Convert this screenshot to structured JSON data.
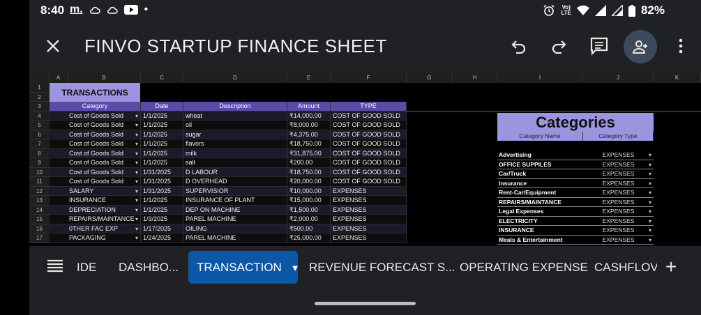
{
  "status_bar": {
    "time": "8:40",
    "battery": "82%",
    "left_icons": [
      "m-app-icon",
      "cloud-icon",
      "cloud-icon",
      "youtube-icon",
      "dot-icon"
    ],
    "right_icons": [
      "alarm-icon",
      "volte-icon",
      "wifi-icon",
      "signal-icon",
      "signal-icon",
      "battery-icon"
    ]
  },
  "app_bar": {
    "title": "FINVO STARTUP FINANCE SHEET",
    "icons": [
      "close-icon",
      "undo-icon",
      "redo-icon",
      "comment-icon",
      "add-person-icon",
      "more-vert-icon"
    ]
  },
  "sheet": {
    "column_headers": [
      "A",
      "B",
      "C",
      "D",
      "E",
      "F",
      "G",
      "H",
      "I",
      "J",
      "K"
    ],
    "row_numbers": [
      "1",
      "2",
      "3",
      "4",
      "5",
      "6",
      "7",
      "8",
      "9",
      "10",
      "11",
      "12",
      "13",
      "14",
      "15",
      "16",
      "17"
    ],
    "transactions_title": "TRANSACTIONS",
    "table_headers": [
      "Category",
      "Date",
      "Description",
      "Amount",
      "TYPE"
    ],
    "rows": [
      {
        "category": "Cost of Goods Sold",
        "date": "1/1/2025",
        "description": "wheat",
        "amount": "₹14,000.00",
        "type": "COST OF GOOD SOLD"
      },
      {
        "category": "Cost of Goods Sold",
        "date": "1/1/2025",
        "description": "oil",
        "amount": "₹8,000.00",
        "type": "COST OF GOOD SOLD"
      },
      {
        "category": "Cost of Goods Sold",
        "date": "1/1/2025",
        "description": "sugar",
        "amount": "₹4,375.00",
        "type": "COST OF GOOD SOLD"
      },
      {
        "category": "Cost of Goods Sold",
        "date": "1/1/2025",
        "description": "flavors",
        "amount": "₹18,750.00",
        "type": "COST OF GOOD SOLD"
      },
      {
        "category": "Cost of Goods Sold",
        "date": "1/1/2025",
        "description": "milk",
        "amount": "₹31,875.00",
        "type": "COST OF GOOD SOLD"
      },
      {
        "category": "Cost of Goods Sold",
        "date": "1/1/2025",
        "description": "salt",
        "amount": "₹200.00",
        "type": "COST OF GOOD SOLD"
      },
      {
        "category": "Cost of Goods Sold",
        "date": "1/31/2025",
        "description": "D LABOUR",
        "amount": "₹18,750.00",
        "type": "COST OF GOOD SOLD"
      },
      {
        "category": "Cost of Goods Sold",
        "date": "1/31/2025",
        "description": "D OVERHEAD",
        "amount": "₹20,000.00",
        "type": "COST OF GOOD SOLD"
      },
      {
        "category": "SALARY",
        "date": "1/31/2025",
        "description": "SUPERVISIOR",
        "amount": "₹10,000.00",
        "type": "EXPENSES"
      },
      {
        "category": "INSURANCE",
        "date": "1/1/2025",
        "description": "INSURANCE OF PLANT",
        "amount": "₹15,000.00",
        "type": "EXPENSES"
      },
      {
        "category": "DEPRECIATION",
        "date": "1/1/2025",
        "description": "DEP ON  MACHINE",
        "amount": "₹1,500.00",
        "type": "EXPENSES"
      },
      {
        "category": "REPAIRS/MAINTANCE",
        "date": "1/3/2025",
        "description": "PAREL MACHINE",
        "amount": "₹2,000.00",
        "type": "EXPENSES"
      },
      {
        "category": "0THER FAC EXP",
        "date": "1/17/2025",
        "description": "OILING",
        "amount": "₹500.00",
        "type": "EXPENSES"
      },
      {
        "category": "PACKAGING",
        "date": "1/24/2025",
        "description": "PAREL MACHINE",
        "amount": "₹25,000.00",
        "type": "EXPENSES"
      }
    ],
    "categories": {
      "title": "Categories",
      "headers": [
        "Category Name",
        "Category Type"
      ],
      "rows": [
        {
          "name": "Advertising",
          "type": "EXPENSES"
        },
        {
          "name": "OFFICE SUPPILES",
          "type": "EXPENSES"
        },
        {
          "name": "Car/Truck",
          "type": "EXPENSES"
        },
        {
          "name": "Insurance",
          "type": "EXPENSES"
        },
        {
          "name": "Rent-Car/Equipment",
          "type": "EXPENSES"
        },
        {
          "name": "REPAIRS/MAINTANCE",
          "type": "EXPENSES"
        },
        {
          "name": "Legal Expenses",
          "type": "EXPENSES"
        },
        {
          "name": "ELECTRICITY",
          "type": "EXPENSES"
        },
        {
          "name": "INSURANCE",
          "type": "EXPENSES"
        },
        {
          "name": "Meals & Entertainment",
          "type": "EXPENSES"
        }
      ]
    }
  },
  "tabs": {
    "items": [
      "IDE",
      "DASHBO...",
      "TRANSACTION",
      "REVENUE FORECAST S...",
      "OPERATING EXPENSE",
      "CASHFLOV"
    ],
    "active": "TRANSACTION"
  },
  "colors": {
    "header_purple": "#5c4aa8",
    "title_lavender": "#9d94e0",
    "active_tab": "#0b57a8",
    "share_button": "#3c4a5c"
  }
}
